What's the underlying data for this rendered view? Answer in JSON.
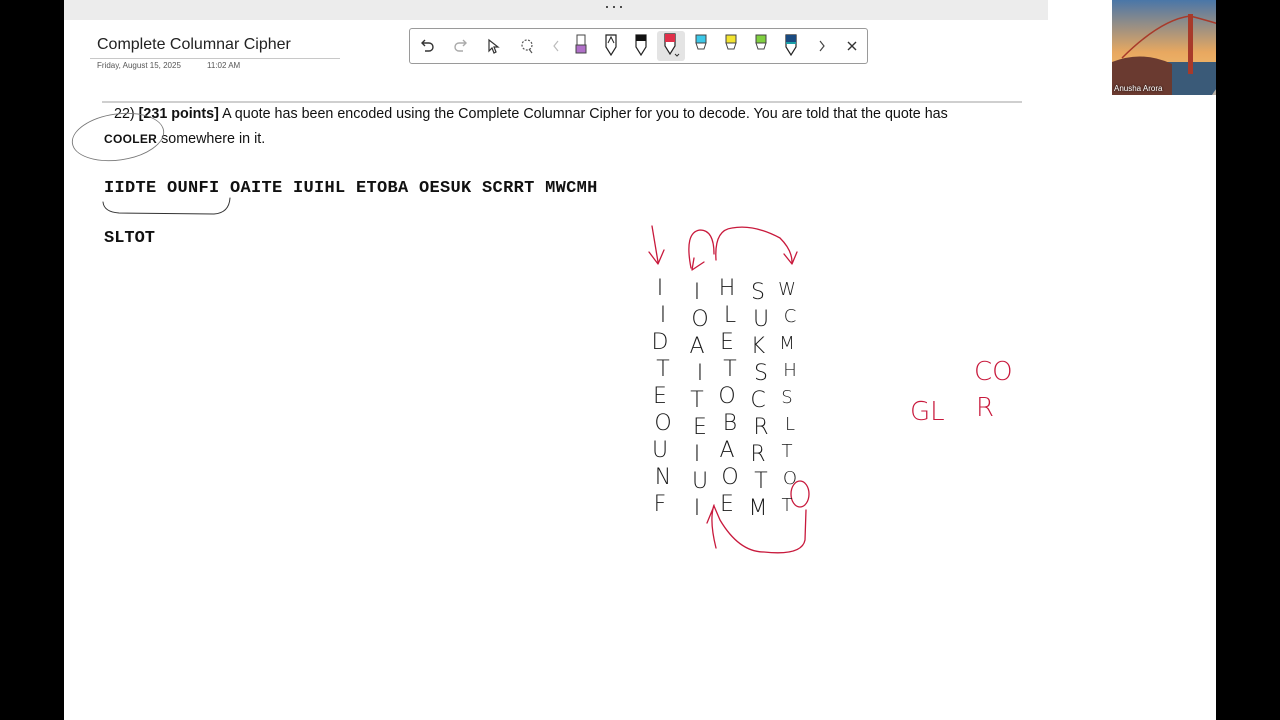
{
  "window": {
    "more_dots": "···"
  },
  "note": {
    "title": "Complete Columnar Cipher",
    "date": "Friday, August 15, 2025",
    "time": "11:02 AM"
  },
  "toolbar": {
    "tools": [
      "undo-icon",
      "redo-icon",
      "select-icon",
      "lasso-icon",
      "scroll-left-icon",
      "highlighter-purple",
      "pen-black-outline",
      "pen-black",
      "pen-red",
      "highlighter-cyan",
      "highlighter-yellow",
      "highlighter-green",
      "pen-teal",
      "scroll-right-icon",
      "close-icon"
    ],
    "active_tool": "pen-red",
    "colors": {
      "purple": "#b070c8",
      "red": "#e0304a",
      "cyan": "#3cc8e8",
      "yellow": "#f2e430",
      "green": "#80d040",
      "teal": "#1aa0a8"
    }
  },
  "question": {
    "number": "22)",
    "points": "[231 points]",
    "text1": " A quote has been encoded using the Complete Columnar Cipher for you to decode. You are told that the quote has",
    "keyword": "COOLER",
    "text2": " somewhere in it."
  },
  "ciphertext": {
    "line1": "IIDTE OUNFI OAITE IUIHL ETOBA OESUK SCRRT MWCMH",
    "line2": "SLTOT"
  },
  "ink_color": "#c8193c",
  "handwriting": {
    "col1": [
      "I",
      "I",
      "D",
      "T",
      "E",
      "O",
      "U",
      "N",
      "F"
    ],
    "col2": [
      "I",
      "O",
      "A",
      "I",
      "T",
      "E",
      "I",
      "U",
      "I"
    ],
    "col3": [
      "H",
      "L",
      "E",
      "T",
      "O",
      "B",
      "A",
      "O",
      "E"
    ],
    "col4": [
      "S",
      "U",
      "K",
      "S",
      "C",
      "R",
      "R",
      "T",
      "M"
    ],
    "col5": [
      "W",
      "C",
      "M",
      "H",
      "S",
      "L",
      "T",
      "O",
      "T"
    ],
    "side_note": [
      "GL",
      "CO",
      "R"
    ]
  },
  "webcam": {
    "name": "Anusha Arora"
  }
}
